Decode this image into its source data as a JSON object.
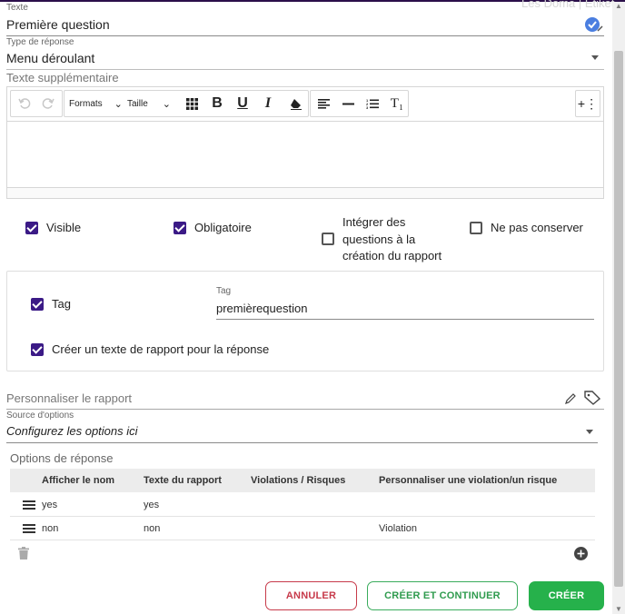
{
  "background_text": "Les Doma | Etiket",
  "texte": {
    "label": "Texte",
    "value": "Première question"
  },
  "type_reponse": {
    "label": "Type de réponse",
    "value": "Menu déroulant"
  },
  "texte_supp": {
    "label": "Texte supplémentaire"
  },
  "toolbar": {
    "formats": "Formats",
    "taille": "Taille",
    "bold": "B",
    "underline": "U",
    "italic": "I",
    "clear_format": "T₁",
    "more": "+⋮"
  },
  "checkboxes": {
    "visible": {
      "label": "Visible",
      "checked": true
    },
    "obligatoire": {
      "label": "Obligatoire",
      "checked": true
    },
    "integrer": {
      "label_lines": [
        "Intégrer des",
        "questions à la",
        "création du rapport"
      ],
      "checked": false
    },
    "ne_pas_conserver": {
      "label": "Ne pas conserver",
      "checked": false
    }
  },
  "tag_card": {
    "tag_checkbox": {
      "label": "Tag",
      "checked": true
    },
    "tag_field": {
      "label": "Tag",
      "value": "premièrequestion"
    },
    "rapport_checkbox": {
      "label": "Créer un texte de rapport pour la réponse",
      "checked": true
    }
  },
  "personnaliser": {
    "placeholder": "Personnaliser le rapport"
  },
  "source_options": {
    "label": "Source d'options",
    "value": "Configurez les options ici"
  },
  "options": {
    "title": "Options de réponse",
    "columns": [
      "Afficher le nom",
      "Texte du rapport",
      "Violations / Risques",
      "Personnaliser une violation/un risque"
    ],
    "rows": [
      {
        "nom": "yes",
        "rapport": "yes",
        "violations": "",
        "personnaliser": ""
      },
      {
        "nom": "non",
        "rapport": "non",
        "violations": "",
        "personnaliser": "Violation"
      }
    ]
  },
  "buttons": {
    "annuler": "ANNULER",
    "creer_continuer": "CRÉER ET CONTINUER",
    "creer": "CRÉER"
  },
  "colors": {
    "accent_purple": "#3b1a86",
    "cancel_red": "#c73a4a",
    "create_green": "#26b14b",
    "check_blue": "#4a7ee0"
  }
}
